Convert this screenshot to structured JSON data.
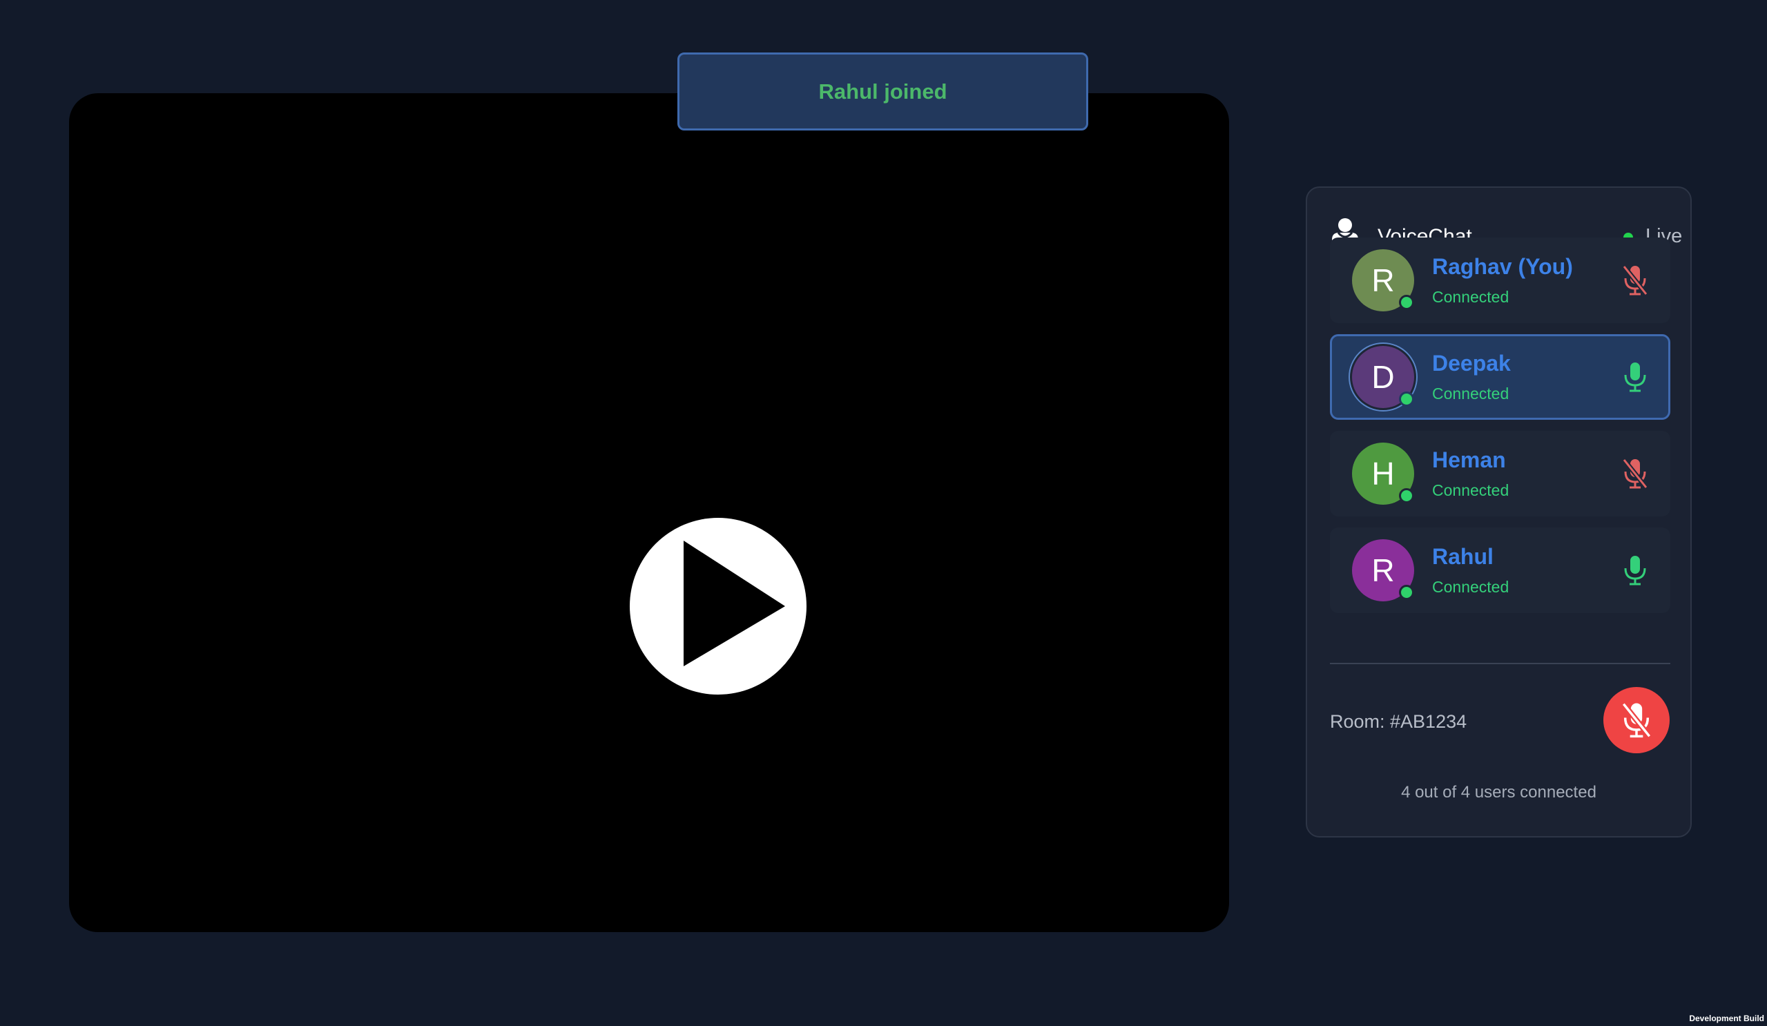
{
  "toast": {
    "text": "Rahul joined"
  },
  "video": {
    "play_icon": "play-icon"
  },
  "panel": {
    "title": "VoiceChat",
    "header_icon": "user-icon",
    "live_label": "Live",
    "participants": [
      {
        "initial": "R",
        "name": "Raghav (You)",
        "status": "Connected",
        "mic": "mic-muted-icon",
        "avatar_color": "#6e8c52"
      },
      {
        "initial": "D",
        "name": "Deepak",
        "status": "Connected",
        "mic": "mic-icon",
        "avatar_color": "#5b3a7a",
        "active": true
      },
      {
        "initial": "H",
        "name": "Heman",
        "status": "Connected",
        "mic": "mic-muted-icon",
        "avatar_color": "#4f9a40"
      },
      {
        "initial": "R",
        "name": "Rahul",
        "status": "Connected",
        "mic": "mic-icon",
        "avatar_color": "#8a2f9a"
      }
    ],
    "room_label": "Room: #AB1234",
    "mute_button_icon": "mic-muted-icon",
    "users_connected": "4 out of 4 users connected"
  },
  "footer": {
    "dev_build": "Development Build"
  },
  "colors": {
    "background": "#121a2a",
    "name_blue": "#3d82e8",
    "status_green": "#34d07a",
    "toast_text": "#4cb86a",
    "mute_red": "#ef4444",
    "live_green": "#22d34e"
  }
}
